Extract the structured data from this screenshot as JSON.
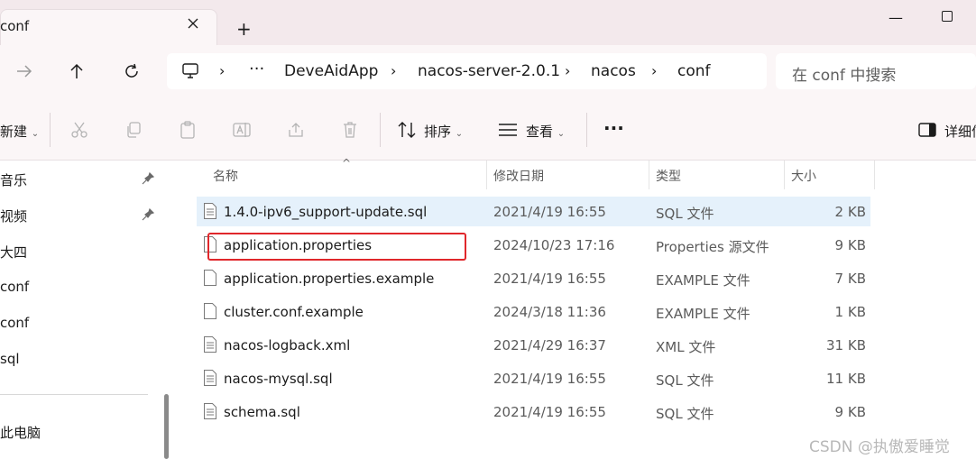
{
  "window": {
    "tab_title": "conf",
    "new_tab_glyph": "+",
    "minimize_glyph": "—"
  },
  "address_bar": {
    "overflow_glyph": "···",
    "breadcrumbs": [
      "DeveAidApp",
      "nacos-server-2.0.1",
      "nacos",
      "conf"
    ],
    "search_placeholder": "在 conf 中搜索"
  },
  "command_bar": {
    "new_label": "新建",
    "sort_label": "排序",
    "view_label": "查看",
    "more_glyph": "···",
    "details_label": "详细信"
  },
  "sidebar": {
    "items": [
      "音乐",
      "视频",
      "大四",
      "conf",
      "conf",
      "sql",
      "此电脑"
    ]
  },
  "file_list": {
    "columns": [
      "名称",
      "修改日期",
      "类型",
      "大小"
    ],
    "sort_indicator": "^",
    "rows": [
      {
        "name": "1.4.0-ipv6_support-update.sql",
        "modified": "2021/4/19 16:55",
        "type": "SQL 文件",
        "size": "2 KB",
        "selected": true
      },
      {
        "name": "application.properties",
        "modified": "2024/10/23 17:16",
        "type": "Properties 源文件",
        "size": "9 KB",
        "selected": false
      },
      {
        "name": "application.properties.example",
        "modified": "2021/4/19 16:55",
        "type": "EXAMPLE 文件",
        "size": "7 KB",
        "selected": false
      },
      {
        "name": "cluster.conf.example",
        "modified": "2024/3/18 11:36",
        "type": "EXAMPLE 文件",
        "size": "1 KB",
        "selected": false
      },
      {
        "name": "nacos-logback.xml",
        "modified": "2021/4/29 16:37",
        "type": "XML 文件",
        "size": "31 KB",
        "selected": false
      },
      {
        "name": "nacos-mysql.sql",
        "modified": "2021/4/19 16:55",
        "type": "SQL 文件",
        "size": "11 KB",
        "selected": false
      },
      {
        "name": "schema.sql",
        "modified": "2021/4/19 16:55",
        "type": "SQL 文件",
        "size": "9 KB",
        "selected": false
      }
    ]
  },
  "watermark": "CSDN @执傲爱睡觉",
  "colors": {
    "title_bar": "#f3e9ec",
    "toolbar": "#fbf6f7",
    "selection": "#e5f1fb",
    "annotation": "#e0272b"
  }
}
